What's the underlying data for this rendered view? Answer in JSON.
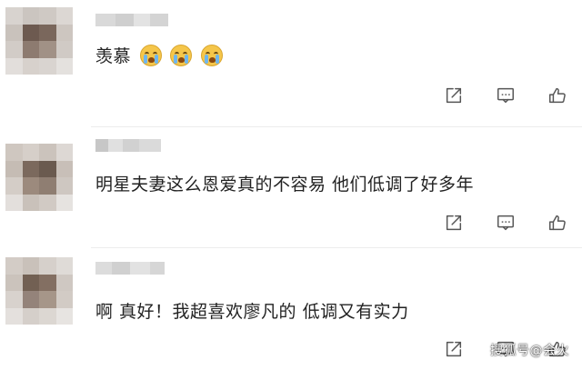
{
  "comments": [
    {
      "text": "羡慕",
      "reactions": [
        "crying-face-emoji",
        "crying-face-emoji",
        "crying-face-emoji"
      ]
    },
    {
      "text": "明星夫妻这么恩爱真的不容易 他们低调了好多年"
    },
    {
      "text": "啊 真好！我超喜欢廖凡的 低调又有实力"
    }
  ],
  "actions": [
    "share-icon",
    "comment-icon",
    "like-icon"
  ],
  "watermark": "搜狐号@会火"
}
